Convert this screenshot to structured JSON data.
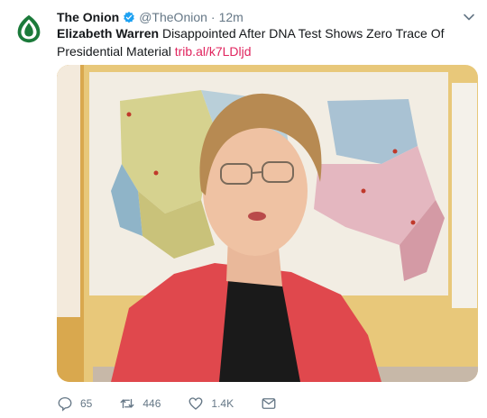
{
  "tweet": {
    "author_name": "The Onion",
    "handle": "@TheOnion",
    "separator": "·",
    "time": "12m",
    "headline_bold": "Elizabeth Warren",
    "headline_rest": " Disappointed After DNA Test Shows Zero Trace Of Presidential Material",
    "link": "trib.al/k7LDljd"
  },
  "actions": {
    "replies": "65",
    "retweets": "446",
    "likes": "1.4K"
  },
  "colors": {
    "brand_green": "#1b7a3a",
    "verified_blue": "#1da1f2",
    "link_color": "#e0245e",
    "muted": "#657786"
  }
}
